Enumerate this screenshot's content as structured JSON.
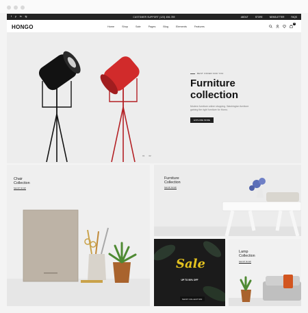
{
  "topbar": {
    "social": [
      "f",
      "y",
      "in",
      "ig"
    ],
    "support": "CUSTOMER SUPPORT (123) 456-789",
    "links": [
      "ABOUT",
      "STORE",
      "NEWSLETTER",
      "FAQS"
    ]
  },
  "nav": {
    "logo": "HONGO",
    "menu": [
      "Home",
      "Shop",
      "Sale",
      "Pages",
      "Blog",
      "Elements",
      "Features"
    ],
    "cart_count": "0"
  },
  "hero": {
    "eyebrow": "BEST OFFER FOR YOU",
    "title_line1": "Furniture",
    "title_line2": "collection",
    "description": "Modern furniture online shopping. Washington furniture gaining the right furniture for Homo.",
    "button": "EXPLORE MORE",
    "pager": [
      "01",
      "02"
    ]
  },
  "tiles": {
    "chair": {
      "title_line1": "Chair",
      "title_line2": "Collection",
      "link": "SHOP NOW"
    },
    "furniture": {
      "title_line1": "Furniture",
      "title_line2": "Collection",
      "link": "SHOP NOW"
    },
    "sale": {
      "word": "Sale",
      "sub": "UP TO 50% OFF",
      "button": "SHOP COLLECTION"
    },
    "lamp": {
      "title_line1": "Lamp",
      "title_line2": "Collection",
      "link": "SHOP NOW"
    }
  },
  "book_text": "THE THOUSAND ARE THINGS",
  "colors": {
    "accent": "#d12b2b",
    "dark": "#232323",
    "sale_yellow": "#e3c21f"
  }
}
